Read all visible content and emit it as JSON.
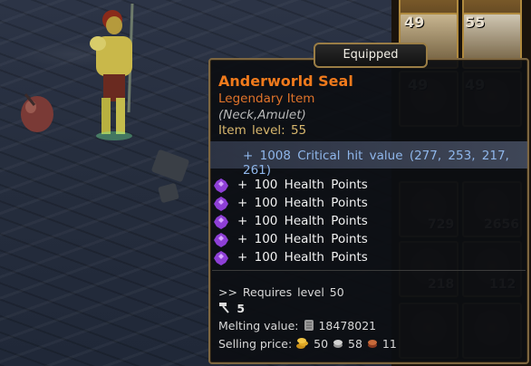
{
  "tooltip": {
    "tab_label": "Equipped",
    "item_name": "Anderworld Seal",
    "rarity": "Legendary Item",
    "slot_type": "(Neck,Amulet)",
    "item_level": "Item level: 55",
    "critical_line": "+ 1008 Critical hit value (277, 253, 217, 261)",
    "bonuses": [
      "+ 100 Health Points",
      "+ 100 Health Points",
      "+ 100 Health Points",
      "+ 100 Health Points",
      "+ 100 Health Points"
    ],
    "requires": ">> Requires level 50",
    "socket_count": "5",
    "melting_label": "Melting value:",
    "melting_value": "18478021",
    "selling_label": "Selling price:",
    "selling_gold": "50",
    "selling_silver": "58",
    "selling_copper": "11"
  },
  "inventory": {
    "slot_levels": [
      "49",
      "55"
    ],
    "slot_levels_dim": [
      "49",
      "49"
    ],
    "quantities": [
      "729",
      "2656",
      "218",
      "112"
    ]
  },
  "colors": {
    "item_name": "#f07a1c",
    "rarity": "#e0732a",
    "critical": "#8fb6ea",
    "item_level": "#d9b86e",
    "border": "#7d6640"
  },
  "icons": {
    "bonus_gem": "purple-gem-icon",
    "socket": "hammer-icon",
    "melting": "scroll-icon",
    "gold": "gold-coin-icon",
    "silver": "silver-coin-icon",
    "copper": "copper-coin-icon"
  }
}
